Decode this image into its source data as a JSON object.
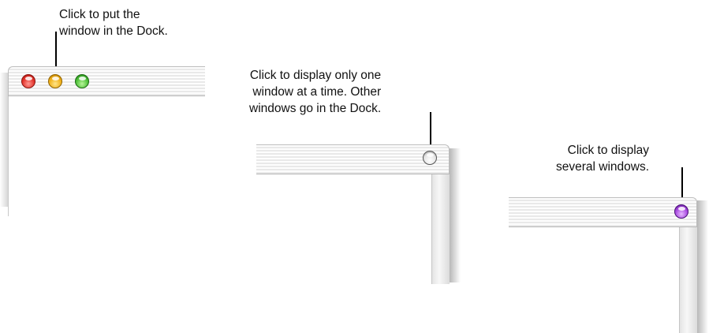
{
  "callouts": {
    "minimize": [
      "Click to put the",
      "window in the Dock."
    ],
    "single_window": [
      "Click to display only one",
      "window at a time. Other",
      "windows go in the Dock."
    ],
    "several_windows": [
      "Click to display",
      "several windows."
    ]
  },
  "buttons": {
    "close": {
      "icon": "close-icon",
      "color": "#e3342c"
    },
    "minimize": {
      "icon": "minimize-icon",
      "color": "#f2b21a"
    },
    "zoom": {
      "icon": "zoom-icon",
      "color": "#4fc13a"
    },
    "single_window_mode": {
      "icon": "single-window-mode-icon",
      "color": "#e5e5e5"
    },
    "multi_window_mode": {
      "icon": "multi-window-mode-icon",
      "color": "#a94be0"
    }
  }
}
